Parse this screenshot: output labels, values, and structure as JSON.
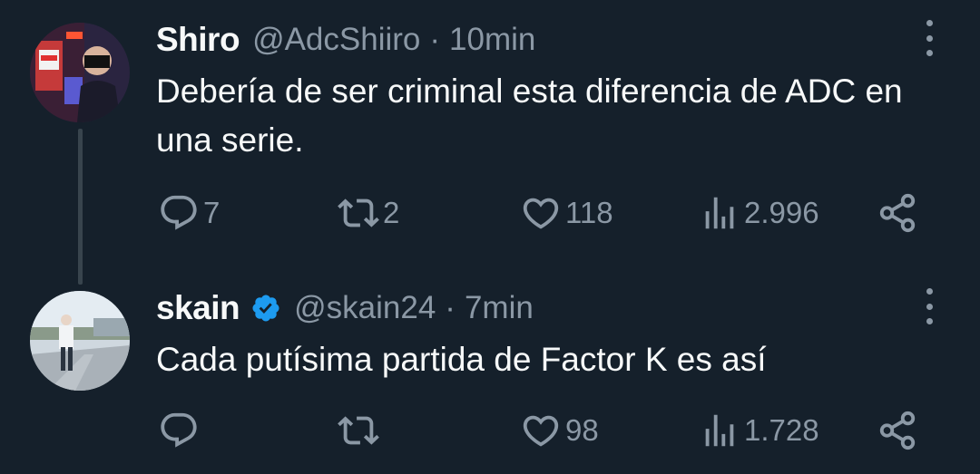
{
  "tweets": [
    {
      "name": "Shiro",
      "handle": "@AdcShiiro",
      "separator": "·",
      "time": "10min",
      "text": "Debería de ser criminal esta diferencia de ADC en una serie.",
      "verified": false,
      "avatar_icon": "gamer-avatar",
      "counts": {
        "replies": "7",
        "retweets": "2",
        "likes": "118",
        "views": "2.996"
      }
    },
    {
      "name": "skain",
      "handle": "@skain24",
      "separator": "·",
      "time": "7min",
      "text": "Cada putísima partida de Factor K es así",
      "verified": true,
      "avatar_icon": "person-street-avatar",
      "counts": {
        "replies": "",
        "retweets": "",
        "likes": "98",
        "views": "1.728"
      }
    }
  ],
  "colors": {
    "background": "#15202b",
    "text": "#f7f9f9",
    "muted": "#8b98a5",
    "verified": "#1d9bf0",
    "thread_line": "#38444d"
  }
}
